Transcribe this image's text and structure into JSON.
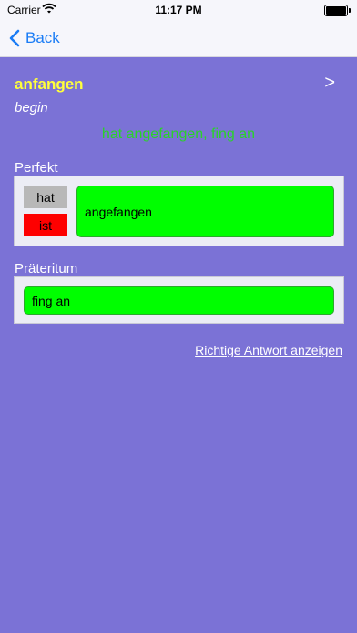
{
  "status_bar": {
    "carrier": "Carrier",
    "time": "11:17 PM",
    "battery_level": 1.0
  },
  "nav": {
    "back_label": "Back"
  },
  "card": {
    "verb": "anfangen",
    "next_symbol": ">",
    "translation": "begin",
    "correct_answer": "hat angefangen, fing an"
  },
  "perfekt": {
    "label": "Perfekt",
    "aux_options": [
      "hat",
      "ist"
    ],
    "participle_value": "angefangen"
  },
  "prateritum": {
    "label": "Präteritum",
    "value": "fing an"
  },
  "show_answer_link": "Richtige Antwort anzeigen",
  "colors": {
    "background": "#7b72d6",
    "verb": "#ffff3c",
    "answer": "#2ad22a",
    "correct_field": "#00fe00",
    "aux_hat": "#b8b8b8",
    "aux_ist": "#fe0000",
    "ios_blue": "#1a7cf5"
  },
  "icons": {
    "back": "chevron-left-icon",
    "wifi": "wifi-icon",
    "battery": "battery-icon"
  }
}
